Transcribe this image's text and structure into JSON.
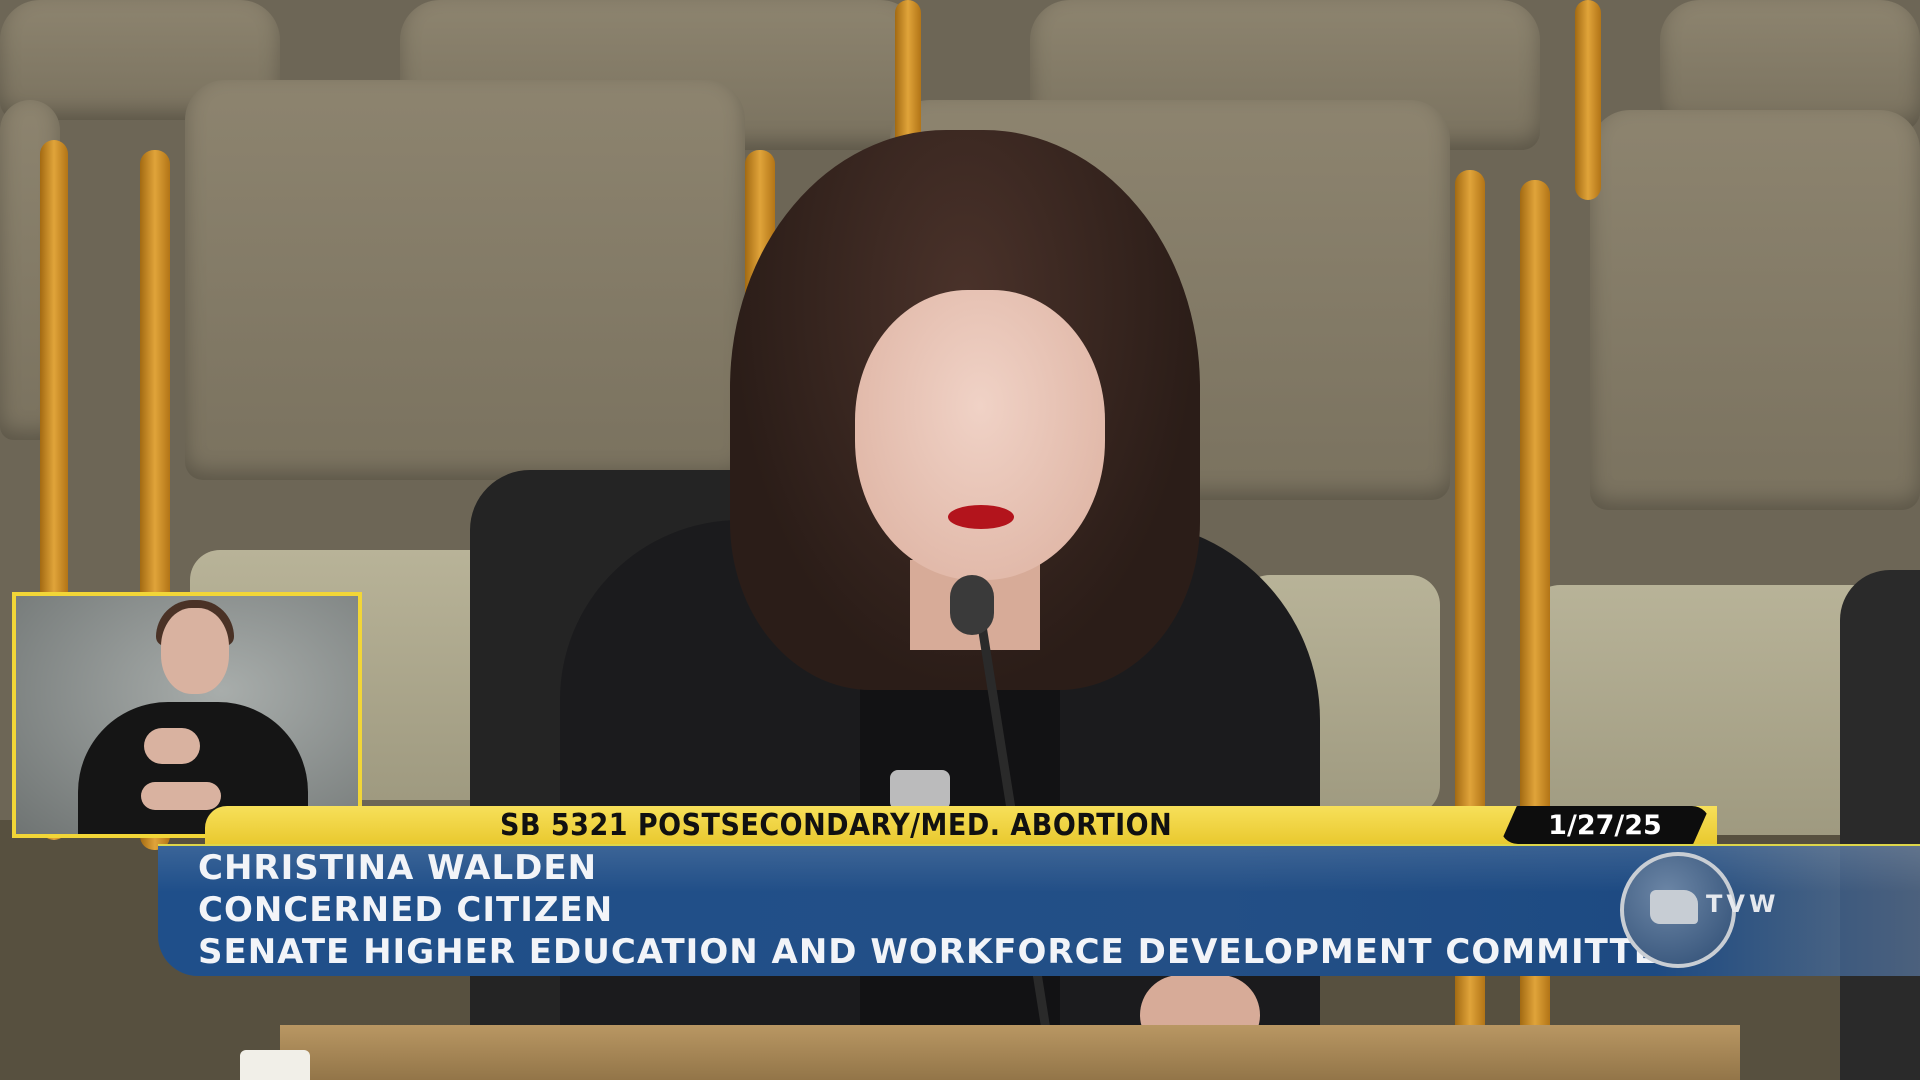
{
  "lower_third": {
    "topic": "SB 5321 POSTSECONDARY/MED. ABORTION",
    "date": "1/27/25",
    "speaker_name": "CHRISTINA WALDEN",
    "speaker_title": "CONCERNED CITIZEN",
    "committee": "SENATE HIGHER EDUCATION AND WORKFORCE DEVELOPMENT COMMITTEE"
  },
  "logo": {
    "text": "TVW"
  },
  "colors": {
    "topic_bar": "#efd23f",
    "name_bar": "#214f87",
    "inset_border": "#f2d637"
  }
}
